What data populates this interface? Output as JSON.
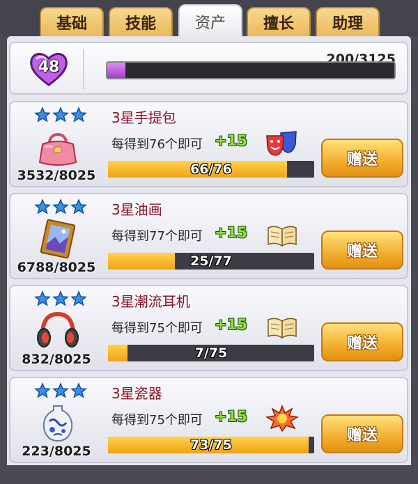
{
  "tabs": [
    {
      "label": "基础",
      "active": false
    },
    {
      "label": "技能",
      "active": false
    },
    {
      "label": "资产",
      "active": true
    },
    {
      "label": "擅长",
      "active": false
    },
    {
      "label": "助理",
      "active": false
    }
  ],
  "level": {
    "value": "48",
    "xp_text": "200/3125",
    "xp_progress": 0.064,
    "heart_color": "#c060e8"
  },
  "items": [
    {
      "name": "3星手提包",
      "stars": 3,
      "stock": "3532/8025",
      "need": "每得到76个即可",
      "bonus": "+15",
      "progress_text": "66/76",
      "progress": 0.868,
      "item_icon": "handbag-icon",
      "category_icon": "theater-masks-icon",
      "button": "赠送"
    },
    {
      "name": "3星油画",
      "stars": 3,
      "stock": "6788/8025",
      "need": "每得到77个即可",
      "bonus": "+15",
      "progress_text": "25/77",
      "progress": 0.325,
      "item_icon": "painting-icon",
      "category_icon": "book-icon",
      "button": "赠送"
    },
    {
      "name": "3星潮流耳机",
      "stars": 3,
      "stock": "832/8025",
      "need": "每得到75个即可",
      "bonus": "+15",
      "progress_text": "7/75",
      "progress": 0.093,
      "item_icon": "headphones-icon",
      "category_icon": "book-icon",
      "button": "赠送"
    },
    {
      "name": "3星瓷器",
      "stars": 3,
      "stock": "223/8025",
      "need": "每得到75个即可",
      "bonus": "+15",
      "progress_text": "73/75",
      "progress": 0.973,
      "item_icon": "porcelain-vase-icon",
      "category_icon": "explosion-icon",
      "button": "赠送"
    }
  ],
  "colors": {
    "accent_gold": "#f0a624",
    "star_blue": "#3a8ee8",
    "item_name": "#8a1424",
    "bonus_green": "#8fe23a"
  }
}
